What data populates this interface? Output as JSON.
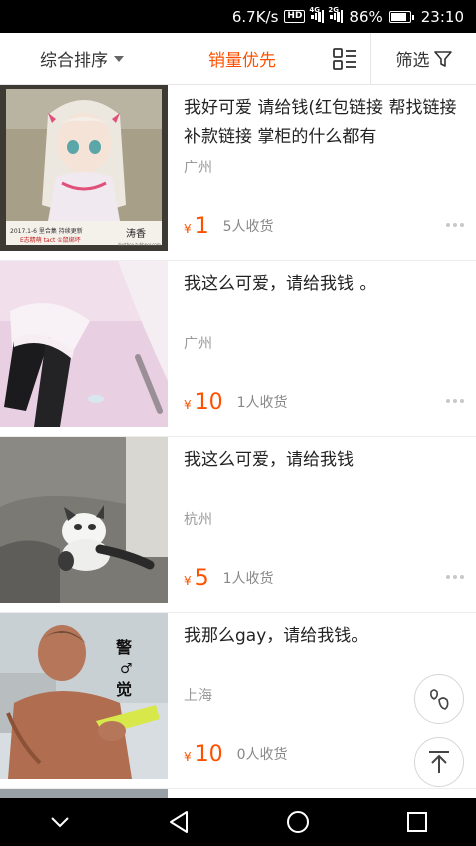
{
  "status_bar": {
    "speed": "6.7K/s",
    "hd": "HD",
    "net1": "4G",
    "net2": "2G",
    "battery": "86%",
    "time": "23:10"
  },
  "sort_bar": {
    "comprehensive": "综合排序",
    "sales_first": "销量优先",
    "filter": "筛选",
    "active_color": "#ff5000"
  },
  "items": [
    {
      "title": "我好可爱 请给钱(红包链接 帮找链接 补款链接 掌柜的什么都有",
      "city": "广州",
      "currency": "¥",
      "price": "1",
      "sold": "5人收货"
    },
    {
      "title": "我这么可爱，请给我钱 。",
      "city": "广州",
      "currency": "¥",
      "price": "10",
      "sold": "1人收货"
    },
    {
      "title": "我这么可爱，请给我钱",
      "city": "杭州",
      "currency": "¥",
      "price": "5",
      "sold": "1人收货"
    },
    {
      "title": "我那么gay，请给我钱。",
      "city": "上海",
      "currency": "¥",
      "price": "10",
      "sold": "0人收货"
    }
  ],
  "thumbs": {
    "anime_caption_line1": "2017.1-6   里合集  持续更新",
    "anime_caption_line2": "E志精萌 tact ①鼠绑坏",
    "anime_signature": "涛香",
    "anime_url": "dusthou.tuhhnor.com",
    "meme_char1": "警",
    "meme_char2": "♂",
    "meme_char3": "觉"
  },
  "icons": [
    "chevron-down-icon",
    "grid-list-icon",
    "filter-funnel-icon",
    "more-dots-icon",
    "footprint-icon",
    "back-to-top-icon",
    "back-icon",
    "home-icon",
    "recents-icon"
  ]
}
